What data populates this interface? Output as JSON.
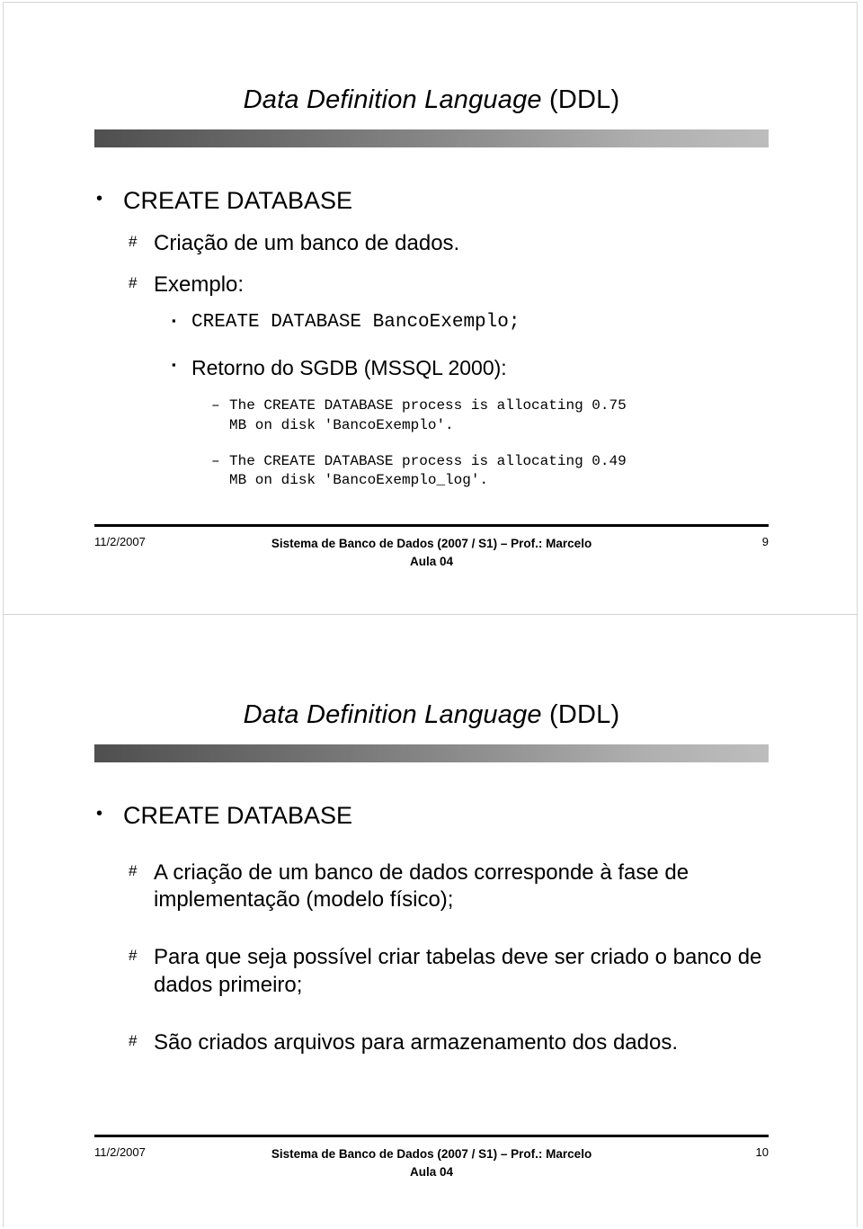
{
  "document": {
    "kind": "lecture-slide-handout",
    "slide_count": 2
  },
  "slides": [
    {
      "title_italic": "Data Definition Language",
      "title_upright": " (DDL)",
      "bullets": {
        "level1": "CREATE DATABASE",
        "level2_a": "Criação de um banco de dados.",
        "level2_b": "Exemplo:",
        "level3_a": "CREATE DATABASE BancoExemplo;",
        "level3_b": "Retorno do SGDB (MSSQL 2000):",
        "level4_a": "The CREATE DATABASE process is allocating 0.75 MB on disk 'BancoExemplo'.",
        "level4_b": "The CREATE DATABASE process is allocating 0.49 MB on disk 'BancoExemplo_log'."
      },
      "markers": {
        "bullet_round": "•",
        "bullet_hash": "#",
        "bullet_square": "▪",
        "bullet_dash": "–"
      },
      "footer": {
        "date": "11/2/2007",
        "center_line1": "Sistema de Banco de Dados (2007 / S1) – Prof.: Marcelo",
        "center_line2": "Aula 04",
        "page": "9"
      }
    },
    {
      "title_italic": "Data Definition Language",
      "title_upright": " (DDL)",
      "bullets": {
        "level1": "CREATE DATABASE",
        "level2_a": "A criação de um banco de dados corresponde à fase de implementação (modelo físico);",
        "level2_b": "Para que seja possível criar tabelas deve ser criado o banco de dados primeiro;",
        "level2_c": "São criados arquivos para armazenamento dos dados."
      },
      "markers": {
        "bullet_round": "•",
        "bullet_hash": "#"
      },
      "footer": {
        "date": "11/2/2007",
        "center_line1": "Sistema de Banco de Dados (2007 / S1) – Prof.: Marcelo",
        "center_line2": "Aula 04",
        "page": "10"
      }
    }
  ],
  "colors": {
    "text": "#000000",
    "bar_gradient_start": "#4f4f4f",
    "bar_gradient_end": "#bdbdbd",
    "page_border": "#d6d6d6",
    "slide_divider": "#d0d0d0"
  }
}
